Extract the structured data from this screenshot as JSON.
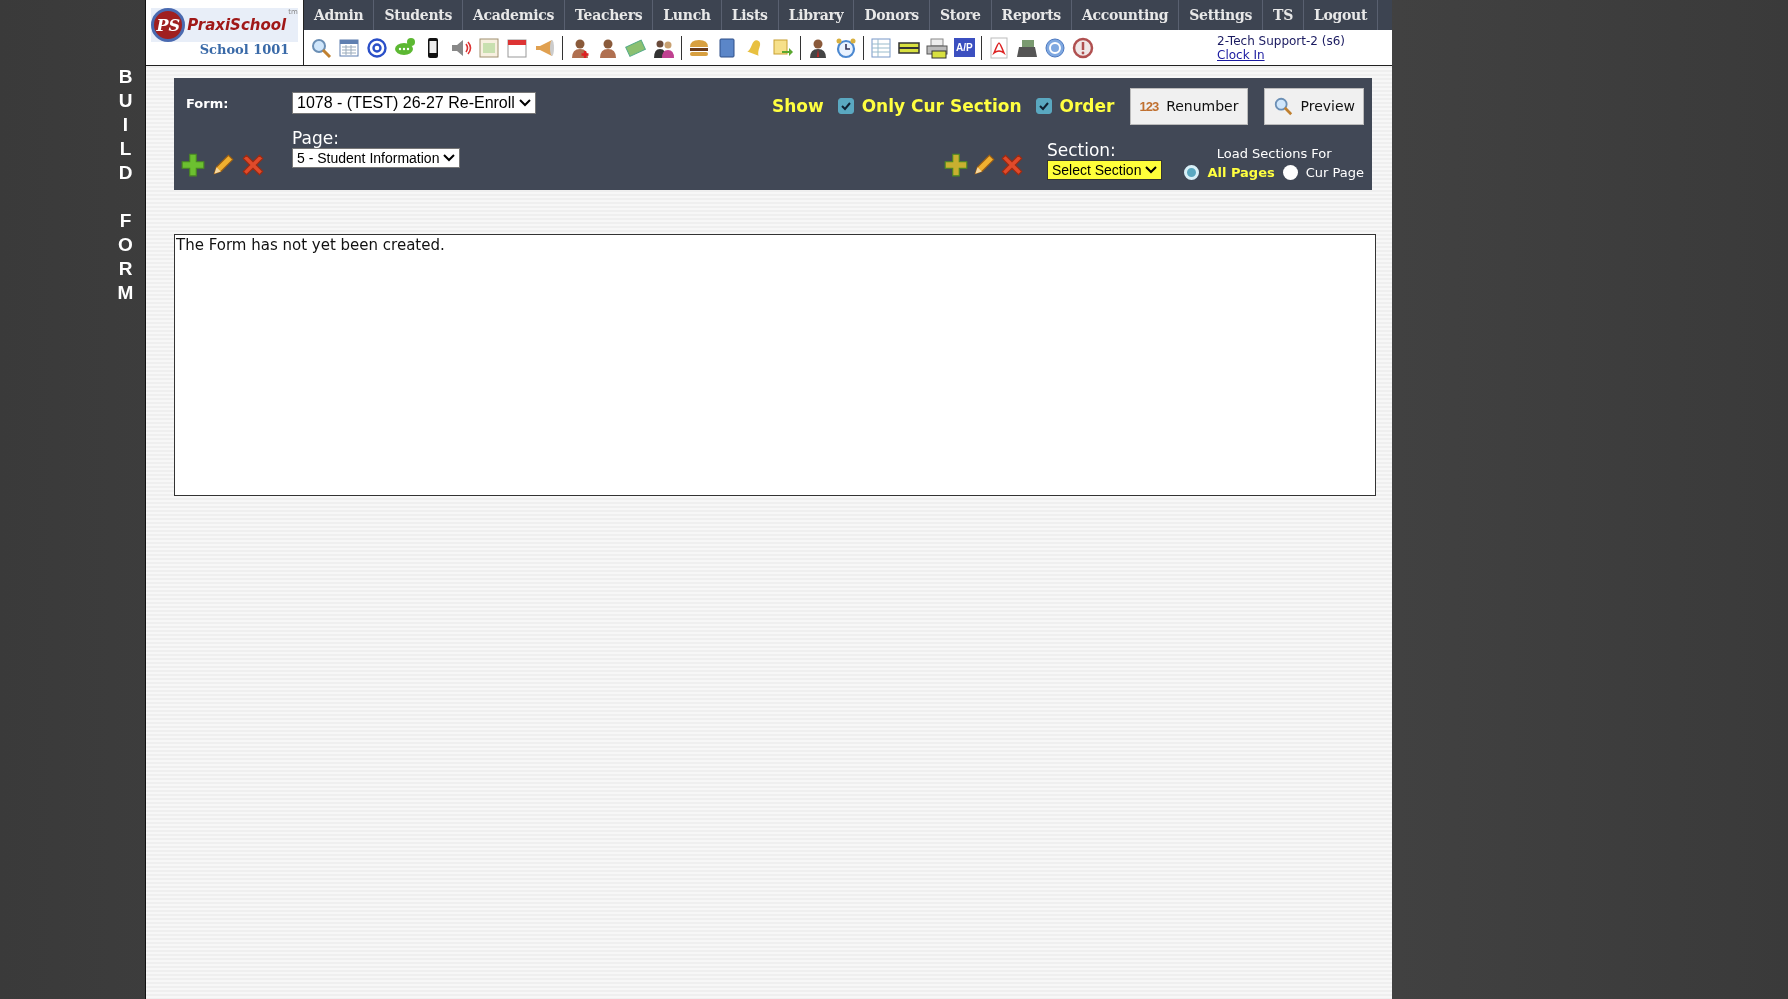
{
  "side_label": "BUILD FORM",
  "logo": {
    "monogram": "PS",
    "brand": "PraxiSchool",
    "tm": "tm",
    "school": "School 1001"
  },
  "nav": [
    {
      "label": "Admin"
    },
    {
      "label": "Students"
    },
    {
      "label": "Academics"
    },
    {
      "label": "Teachers"
    },
    {
      "label": "Lunch"
    },
    {
      "label": "Lists"
    },
    {
      "label": "Library"
    },
    {
      "label": "Donors"
    },
    {
      "label": "Store"
    },
    {
      "label": "Reports"
    },
    {
      "label": "Accounting"
    },
    {
      "label": "Settings"
    },
    {
      "label": "TS"
    },
    {
      "label": "Logout"
    }
  ],
  "toolbar": {
    "ap_icon_text": "A/P"
  },
  "user": {
    "name": "2-Tech Support-2 (s6)",
    "link": "Clock In"
  },
  "form_panel": {
    "form_label": "Form:",
    "form_select": "1078 - (TEST) 26-27 Re-Enroll",
    "page_label": "Page:",
    "page_select": "5 - Student Information",
    "show_label": "Show",
    "options": [
      {
        "label": "Only Cur Section",
        "checked": true
      },
      {
        "label": "Order",
        "checked": true
      }
    ],
    "buttons": [
      {
        "kind": "renumber",
        "label": "Renumber",
        "icon_text": "123"
      },
      {
        "kind": "preview",
        "label": "Preview"
      }
    ],
    "section_label": "Section:",
    "section_select": "Select Section",
    "load_label": "Load Sections For",
    "radios": [
      {
        "label": "All Pages",
        "selected": true
      },
      {
        "label": "Cur Page",
        "selected": false
      }
    ]
  },
  "content": {
    "message": "The Form has not yet been created."
  }
}
